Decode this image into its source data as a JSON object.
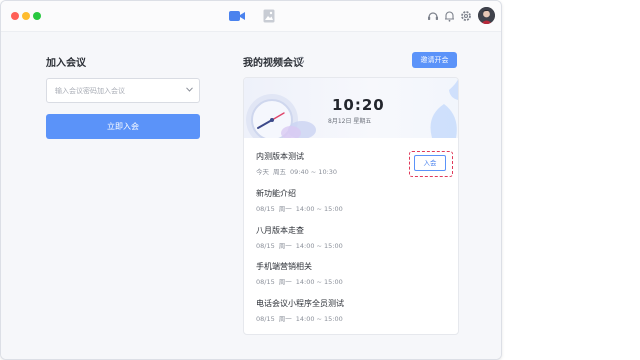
{
  "titlebar": {
    "nav_icons": [
      "video-icon",
      "gallery-icon"
    ],
    "tool_icons": [
      "headset-icon",
      "bell-icon",
      "gear-icon"
    ]
  },
  "join": {
    "title": "加入会议",
    "input_placeholder": "输入会议密码加入会议",
    "input_value": "",
    "join_button": "立即入会"
  },
  "my_meetings": {
    "title": "我的视频会议",
    "invite_button": "邀请开会",
    "clock": {
      "time": "10:20",
      "date": "8月12日 星期五"
    },
    "meetings": [
      {
        "title": "内测版本测试",
        "day": "今天",
        "weekday": "周五",
        "time": "09:40 ~ 10:30",
        "action": "入会"
      },
      {
        "title": "新功能介绍",
        "day": "08/15",
        "weekday": "周一",
        "time": "14:00 ~ 15:00"
      },
      {
        "title": "八月版本走查",
        "day": "08/15",
        "weekday": "周一",
        "time": "14:00 ~ 15:00"
      },
      {
        "title": "手机端营销相关",
        "day": "08/15",
        "weekday": "周一",
        "time": "14:00 ~ 15:00"
      },
      {
        "title": "电话会议小程序全员测试",
        "day": "08/15",
        "weekday": "周一",
        "time": "14:00 ~ 15:00"
      }
    ]
  },
  "colors": {
    "accent": "#5b93f9",
    "highlight": "#e03a5a"
  }
}
